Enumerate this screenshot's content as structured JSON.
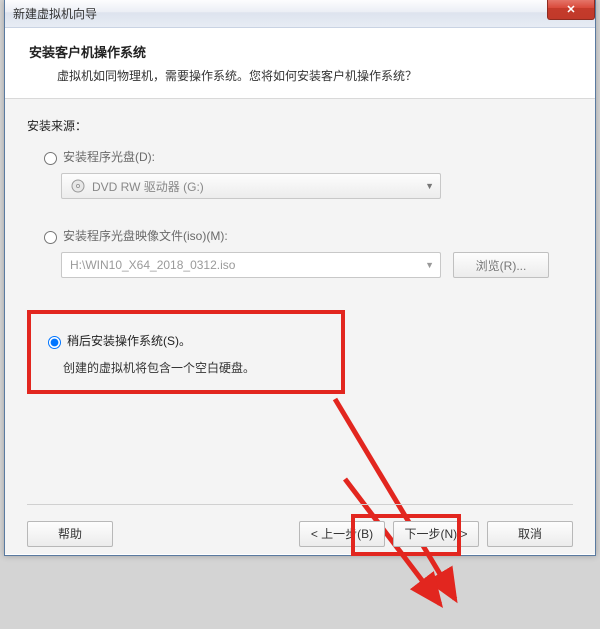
{
  "window": {
    "title": "新建虚拟机向导"
  },
  "header": {
    "title": "安装客户机操作系统",
    "subtitle": "虚拟机如同物理机，需要操作系统。您将如何安装客户机操作系统？"
  },
  "source": {
    "label": "安装来源：",
    "disc_label": "安装程序光盘(D):",
    "disc_value": "DVD RW 驱动器 (G:)",
    "iso_label": "安装程序光盘映像文件(iso)(M):",
    "iso_value": "H:\\WIN10_X64_2018_0312.iso",
    "browse_label": "浏览(R)...",
    "later_label": "稍后安装操作系统(S)。",
    "later_hint": "创建的虚拟机将包含一个空白硬盘。"
  },
  "footer": {
    "help": "帮助",
    "back": "< 上一步(B)",
    "next": "下一步(N) >",
    "cancel": "取消"
  }
}
